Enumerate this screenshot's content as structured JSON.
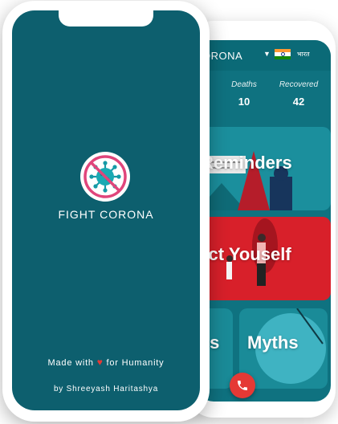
{
  "back_phone": {
    "app_title": "ORONA",
    "lang_label": "भारत",
    "stats": [
      {
        "label": "Deaths",
        "value": "10"
      },
      {
        "label": "Recovered",
        "value": "42"
      }
    ],
    "cards": {
      "reminders": "Reminders",
      "protect": "tect Youself",
      "faqs": "Qs",
      "myths": "Myths"
    },
    "flag_colors": [
      "#ff9933",
      "#ffffff",
      "#138808"
    ],
    "call_icon": "phone-icon"
  },
  "front_phone": {
    "title": "FIGHT CORONA",
    "made_with_prefix": "Made with",
    "made_with_suffix": "for Humanity",
    "author": "by Shreeyash Haritashya",
    "logo_icon": "no-virus-icon",
    "background": "#0d5f6e"
  }
}
